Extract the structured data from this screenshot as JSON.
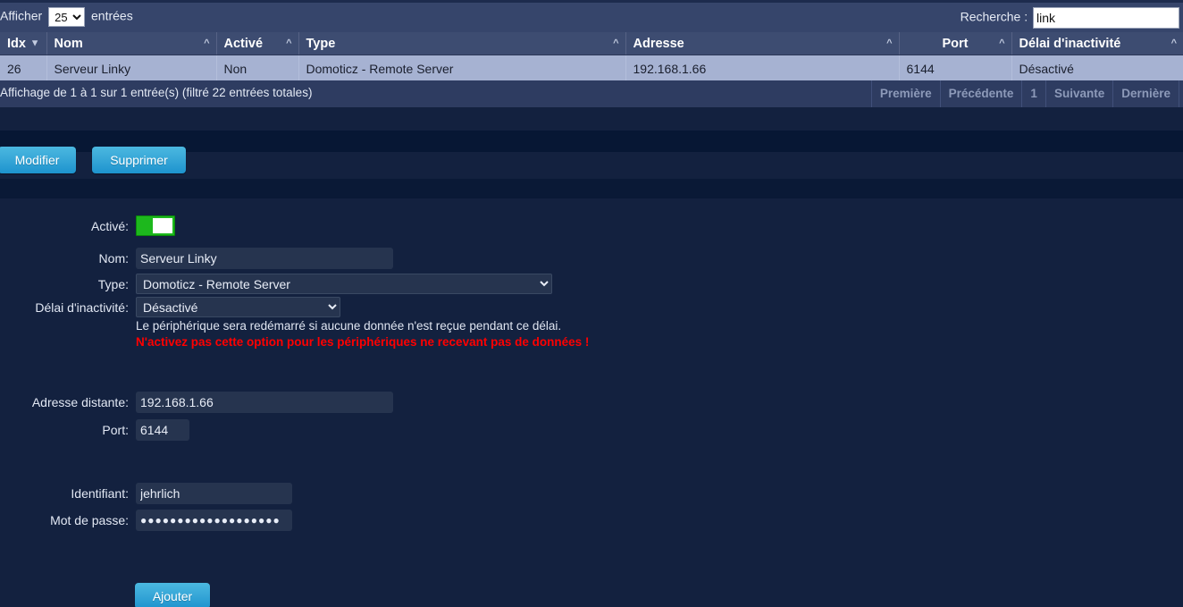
{
  "datatable": {
    "length_prefix": "Afficher",
    "length_suffix": "entrées",
    "length_value": "25",
    "length_options": [
      "25"
    ],
    "filter_label": "Recherche :",
    "filter_value": "link",
    "columns": [
      {
        "label": "Idx",
        "sort": "desc"
      },
      {
        "label": "Nom",
        "sort": "asc"
      },
      {
        "label": "Activé",
        "sort": "asc"
      },
      {
        "label": "Type",
        "sort": "asc"
      },
      {
        "label": "Adresse",
        "sort": "asc"
      },
      {
        "label": "Port",
        "sort": "asc"
      },
      {
        "label": "Délai d'inactivité",
        "sort": "asc"
      }
    ],
    "rows": [
      {
        "idx": "26",
        "nom": "Serveur Linky",
        "active": "Non",
        "type": "Domoticz - Remote Server",
        "adresse": "192.168.1.66",
        "port": "6144",
        "delai": "Désactivé"
      }
    ],
    "info": "Affichage de 1 à 1 sur 1 entrée(s) (filtré 22 entrées totales)",
    "paginate": {
      "first": "Première",
      "previous": "Précédente",
      "page": "1",
      "next": "Suivante",
      "last": "Dernière"
    }
  },
  "actions": {
    "edit_label": "Modifier",
    "delete_label": "Supprimer",
    "add_label": "Ajouter"
  },
  "form": {
    "enabled_label": "Activé:",
    "enabled_state": "on",
    "name_label": "Nom:",
    "name_value": "Serveur Linky",
    "type_label": "Type:",
    "type_value": "Domoticz - Remote Server",
    "type_options": [
      "Domoticz - Remote Server"
    ],
    "timeout_label": "Délai d'inactivité:",
    "timeout_value": "Désactivé",
    "timeout_options": [
      "Désactivé"
    ],
    "timeout_hint": "Le périphérique sera redémarré si aucune donnée n'est reçue pendant ce délai.",
    "timeout_warning": "N'activez pas cette option pour les périphériques ne recevant pas de données !",
    "address_label": "Adresse distante:",
    "address_value": "192.168.1.66",
    "port_label": "Port:",
    "port_value": "6144",
    "username_label": "Identifiant:",
    "username_value": "jehrlich",
    "password_label": "Mot de passe:",
    "password_value": "●●●●●●●●●●●●●●●●●●●"
  },
  "colors": {
    "page_background": "#13213f",
    "header_bar": "#36456b",
    "table_header": "#3d4c71",
    "row_selected": "#a6b2d2",
    "button_blue": "#38a8d8",
    "toggle_on": "#1db81d",
    "warning_red": "#ff0000"
  }
}
